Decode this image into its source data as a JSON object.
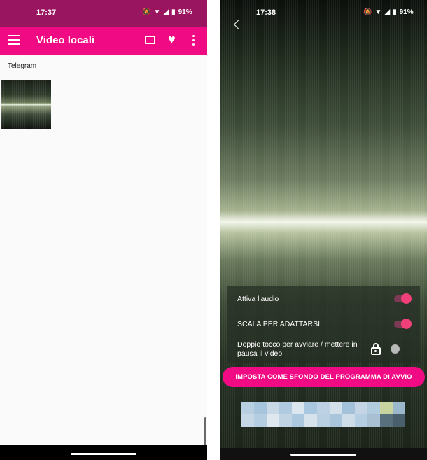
{
  "left_screen": {
    "status_bar": {
      "time": "17:37",
      "battery": "91%"
    },
    "app_bar": {
      "title": "Video locali"
    },
    "folder_label": "Telegram"
  },
  "right_screen": {
    "status_bar": {
      "time": "17:38",
      "battery": "91%"
    },
    "options": {
      "audio_label": "Attiva l'audio",
      "audio_on": true,
      "scale_label": "SCALA PER ADATTARSI",
      "scale_on": true,
      "double_tap_label": "Doppio tocco per avviare / mettere in pausa il video",
      "double_tap_on": false
    },
    "set_button_label": "IMPOSTA COME SFONDO DEL PROGRAMMA DI AVVIO"
  },
  "colors": {
    "accent": "#f00b85",
    "status_bar_left": "#9a1560",
    "toggle_knob": "#f0407a"
  },
  "icons": [
    "menu-icon",
    "cast-icon",
    "heart-icon",
    "more-vert-icon",
    "back-icon",
    "lock-icon"
  ]
}
